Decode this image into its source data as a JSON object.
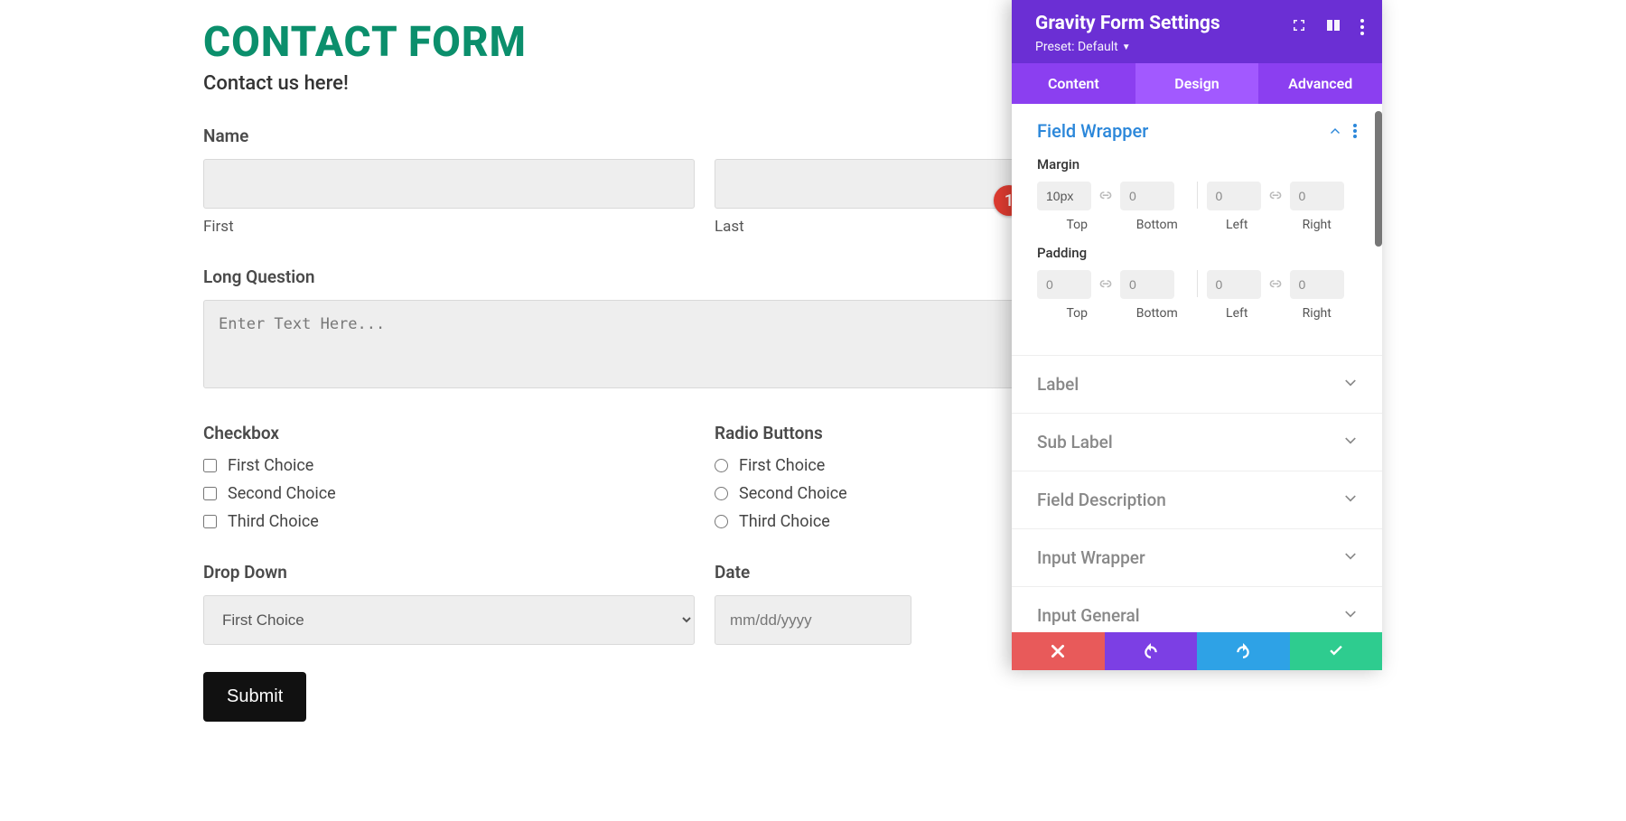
{
  "form": {
    "title": "CONTACT FORM",
    "subtitle": "Contact us here!",
    "name": {
      "label": "Name",
      "first_sublabel": "First",
      "last_sublabel": "Last"
    },
    "long_question": {
      "label": "Long Question",
      "placeholder": "Enter Text Here..."
    },
    "checkbox": {
      "label": "Checkbox",
      "options": [
        "First Choice",
        "Second Choice",
        "Third Choice"
      ]
    },
    "radio": {
      "label": "Radio Buttons",
      "options": [
        "First Choice",
        "Second Choice",
        "Third Choice"
      ]
    },
    "dropdown": {
      "label": "Drop Down",
      "selected": "First Choice"
    },
    "date": {
      "label": "Date",
      "placeholder": "mm/dd/yyyy"
    },
    "submit_label": "Submit"
  },
  "annotation": {
    "badge": "1"
  },
  "panel": {
    "title": "Gravity Form Settings",
    "preset_label": "Preset: Default",
    "tabs": {
      "content": "Content",
      "design": "Design",
      "advanced": "Advanced",
      "active": "design"
    },
    "field_wrapper": {
      "title": "Field Wrapper",
      "margin": {
        "label": "Margin",
        "top_value": "10px",
        "bottom_placeholder": "0",
        "left_placeholder": "0",
        "right_placeholder": "0",
        "sub_top": "Top",
        "sub_bottom": "Bottom",
        "sub_left": "Left",
        "sub_right": "Right"
      },
      "padding": {
        "label": "Padding",
        "top_placeholder": "0",
        "bottom_placeholder": "0",
        "left_placeholder": "0",
        "right_placeholder": "0",
        "sub_top": "Top",
        "sub_bottom": "Bottom",
        "sub_left": "Left",
        "sub_right": "Right"
      }
    },
    "sections": [
      "Label",
      "Sub Label",
      "Field Description",
      "Input Wrapper",
      "Input General"
    ]
  }
}
